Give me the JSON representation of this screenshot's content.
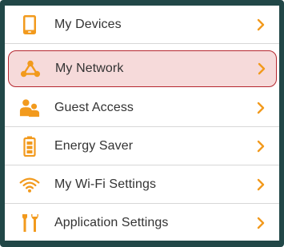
{
  "menu": {
    "items": [
      {
        "label": "My Devices",
        "icon": "phone-icon",
        "selected": false
      },
      {
        "label": "My Network",
        "icon": "network-icon",
        "selected": true
      },
      {
        "label": "Guest Access",
        "icon": "guests-icon",
        "selected": false
      },
      {
        "label": "Energy Saver",
        "icon": "battery-icon",
        "selected": false
      },
      {
        "label": "My Wi-Fi Settings",
        "icon": "wifi-icon",
        "selected": false
      },
      {
        "label": "Application Settings",
        "icon": "tools-icon",
        "selected": false
      }
    ]
  },
  "colors": {
    "frame": "#214747",
    "accent_orange": "#f29a1d",
    "selected_border": "#b5262f",
    "selected_fill": "#f6dada",
    "text": "#333333"
  }
}
